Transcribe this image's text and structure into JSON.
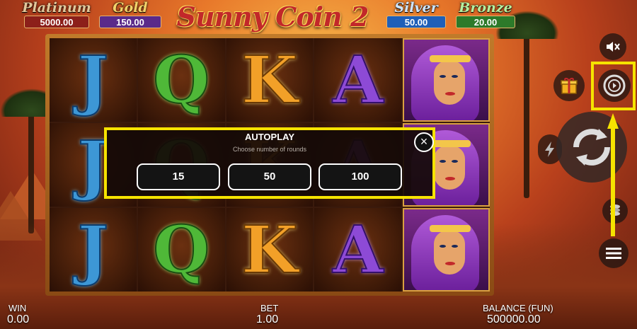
{
  "jackpots": {
    "platinum": {
      "name": "Platinum",
      "value": "5000.00"
    },
    "gold": {
      "name": "Gold",
      "value": "150.00"
    },
    "silver": {
      "name": "Silver",
      "value": "50.00"
    },
    "bronze": {
      "name": "Bronze",
      "value": "20.00"
    }
  },
  "logo": {
    "title": "Sunny Coin 2"
  },
  "reels": {
    "rows": [
      [
        "J",
        "Q",
        "K",
        "A",
        "queen"
      ],
      [
        "J",
        "Q",
        "K",
        "A",
        "queen"
      ],
      [
        "J",
        "Q",
        "K",
        "A",
        "queen"
      ]
    ]
  },
  "autoplay": {
    "title": "AUTOPLAY",
    "subtitle": "Choose number of rounds",
    "close_icon": "×",
    "options": [
      "15",
      "50",
      "100"
    ]
  },
  "controls": {
    "sound_icon": "speaker-muted-icon",
    "gift_icon": "gift-icon",
    "autoplay_icon": "autoplay-icon",
    "turbo_icon": "lightning-icon",
    "spin_icon": "spin-icon",
    "bet_icon": "coin-stack-icon",
    "menu_icon": "hamburger-menu-icon"
  },
  "footer": {
    "win_label": "WIN",
    "win_value": "0.00",
    "bet_label": "BET",
    "bet_value": "1.00",
    "balance_label": "BALANCE (FUN)",
    "balance_value": "500000.00"
  },
  "colors": {
    "highlight": "#f6e300",
    "modal_bg": "#140a08"
  }
}
